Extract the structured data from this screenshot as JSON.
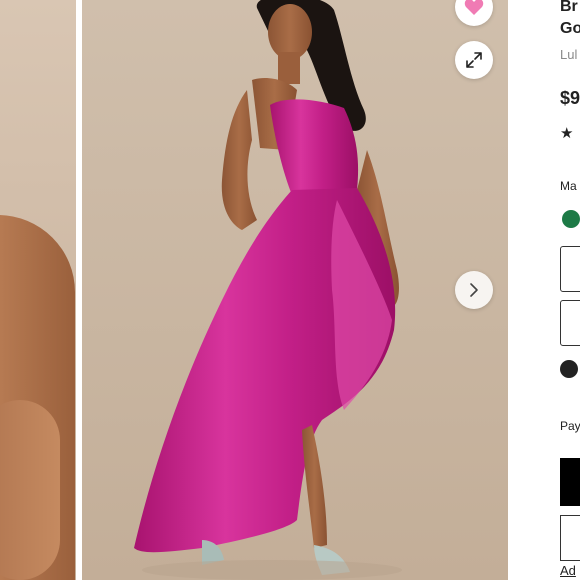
{
  "product": {
    "title_line1": "Br",
    "title_line2": "Go",
    "brand": "Lul",
    "price": "$9",
    "rating_partial": "★"
  },
  "options": {
    "color_label": "Ma",
    "color_swatch": "#1d7a46"
  },
  "payment": {
    "label": "Pay"
  },
  "actions": {
    "add_link": "Ad"
  },
  "icons": {
    "favorite": "heart-icon",
    "expand": "expand-arrows-icon",
    "next": "chevron-right-icon",
    "shipping": "shipping-icon"
  },
  "colors": {
    "dress": "#c8238f",
    "heart": "#f07bb4",
    "background": "#d4c4b2"
  }
}
